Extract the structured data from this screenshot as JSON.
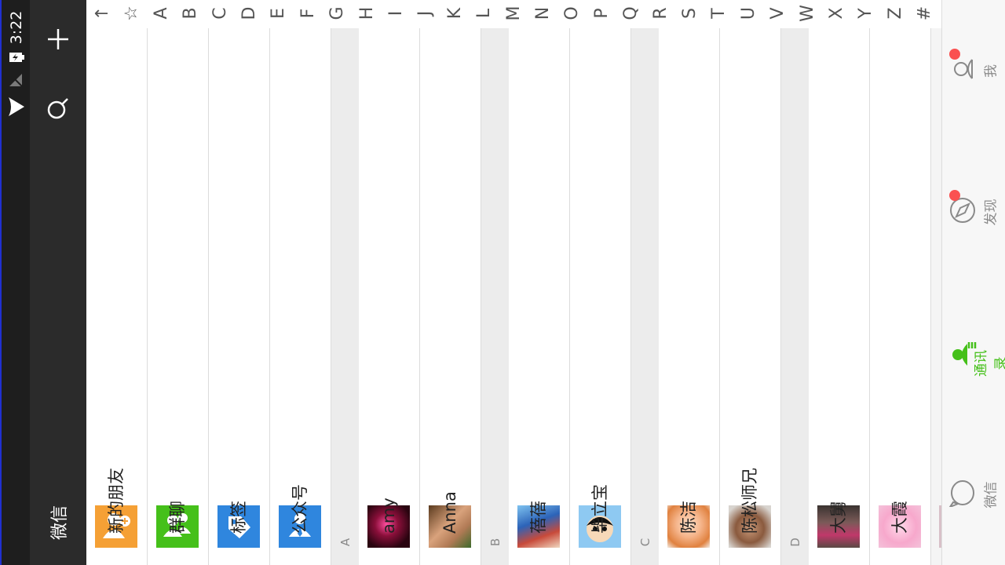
{
  "status_bar": {
    "time": "3:22"
  },
  "action_bar": {
    "title": "微信",
    "add_icon": "plus-icon",
    "search_icon": "search-icon"
  },
  "index_bar": {
    "letters": [
      "↑",
      "☆",
      "A",
      "B",
      "C",
      "D",
      "E",
      "F",
      "G",
      "H",
      "I",
      "J",
      "K",
      "L",
      "M",
      "N",
      "O",
      "P",
      "Q",
      "R",
      "S",
      "T",
      "U",
      "V",
      "W",
      "X",
      "Y",
      "Z",
      "#"
    ]
  },
  "colors": {
    "brand_green": "#45c01a",
    "new_friends": "#f5a035",
    "group_chat": "#45c01a",
    "tags": "#2f86de",
    "official_accounts": "#2f86de",
    "badge_red": "#fa5151"
  },
  "contacts": {
    "fixed": [
      {
        "name": "新的朋友",
        "icon": "add-friend-icon"
      },
      {
        "name": "群聊",
        "icon": "group-chat-icon"
      },
      {
        "name": "标签",
        "icon": "tag-icon"
      },
      {
        "name": "公众号",
        "icon": "official-account-icon"
      }
    ],
    "sections": [
      {
        "letter": "A",
        "items": [
          {
            "name": "amy"
          },
          {
            "name": "Anna"
          }
        ]
      },
      {
        "letter": "B",
        "items": [
          {
            "name": "蓓蓓"
          },
          {
            "name": "毕立宝"
          }
        ]
      },
      {
        "letter": "C",
        "items": [
          {
            "name": "陈洁"
          },
          {
            "name": "陈松师兄"
          }
        ]
      },
      {
        "letter": "D",
        "items": [
          {
            "name": "大舅"
          },
          {
            "name": "大霞"
          }
        ]
      }
    ]
  },
  "tabs": [
    {
      "label": "我",
      "icon": "profile-icon",
      "badge": true
    },
    {
      "label": "发现",
      "icon": "compass-icon",
      "badge": true
    },
    {
      "label": "通讯录",
      "icon": "contacts-icon",
      "active": true
    },
    {
      "label": "微信",
      "icon": "chat-bubble-icon"
    }
  ]
}
